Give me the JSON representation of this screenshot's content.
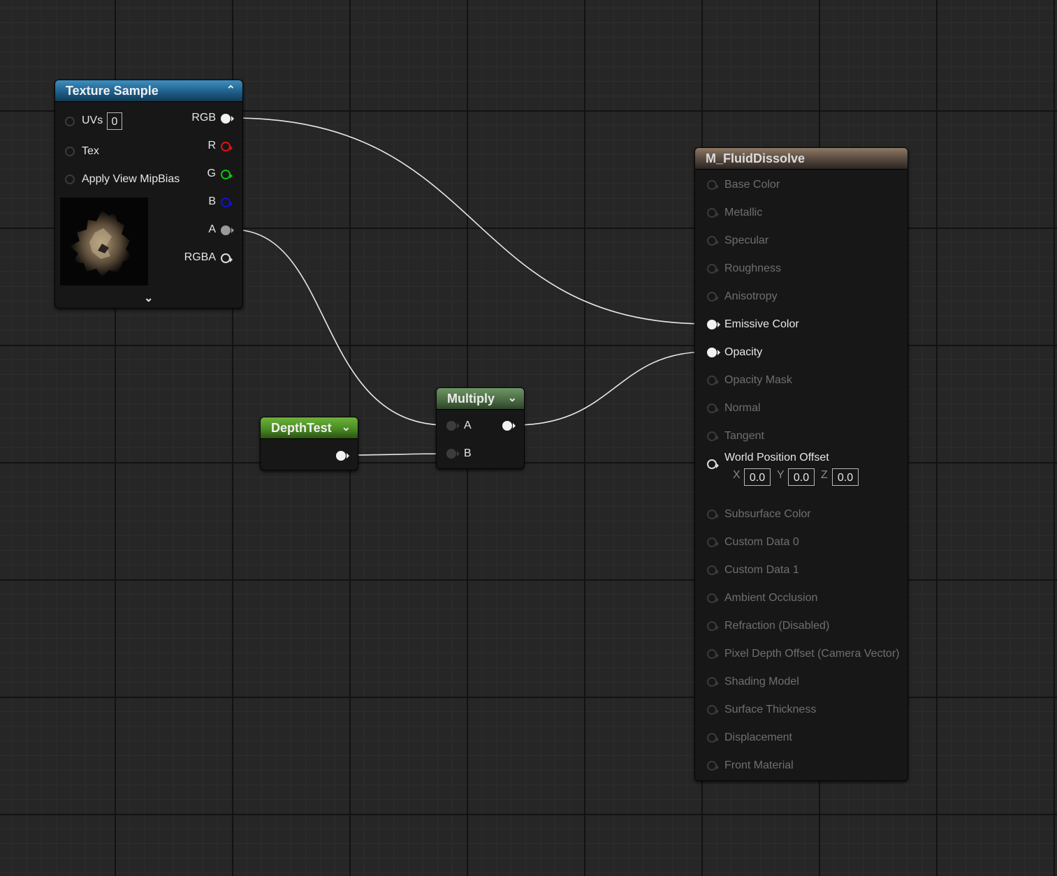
{
  "texture_sample": {
    "title": "Texture Sample",
    "inputs": [
      {
        "label": "UVs",
        "value": "0"
      },
      {
        "label": "Tex"
      },
      {
        "label": "Apply View MipBias"
      }
    ],
    "outputs": [
      "RGB",
      "R",
      "G",
      "B",
      "A",
      "RGBA"
    ]
  },
  "depth_test": {
    "title": "DepthTest"
  },
  "multiply": {
    "title": "Multiply",
    "inputs": [
      "A",
      "B"
    ]
  },
  "material": {
    "title": "M_FluidDissolve",
    "pins": [
      {
        "label": "Base Color",
        "connected": false
      },
      {
        "label": "Metallic",
        "connected": false
      },
      {
        "label": "Specular",
        "connected": false
      },
      {
        "label": "Roughness",
        "connected": false
      },
      {
        "label": "Anisotropy",
        "connected": false
      },
      {
        "label": "Emissive Color",
        "connected": true
      },
      {
        "label": "Opacity",
        "connected": true
      },
      {
        "label": "Opacity Mask",
        "connected": false
      },
      {
        "label": "Normal",
        "connected": false
      },
      {
        "label": "Tangent",
        "connected": false
      },
      {
        "label": "World Position Offset",
        "connected": false,
        "active": true
      },
      {
        "label": "Subsurface Color",
        "connected": false
      },
      {
        "label": "Custom Data 0",
        "connected": false
      },
      {
        "label": "Custom Data 1",
        "connected": false
      },
      {
        "label": "Ambient Occlusion",
        "connected": false
      },
      {
        "label": "Refraction (Disabled)",
        "connected": false
      },
      {
        "label": "Pixel Depth Offset (Camera Vector)",
        "connected": false
      },
      {
        "label": "Shading Model",
        "connected": false
      },
      {
        "label": "Surface Thickness",
        "connected": false
      },
      {
        "label": "Displacement",
        "connected": false
      },
      {
        "label": "Front Material",
        "connected": false
      }
    ],
    "wpo": {
      "x_label": "X",
      "x": "0.0",
      "y_label": "Y",
      "y": "0.0",
      "z_label": "Z",
      "z": "0.0"
    }
  },
  "colors": {
    "red_pin": "#e01010",
    "green_pin": "#10c010",
    "blue_pin": "#1010d8",
    "wire": "#e8e8e8"
  }
}
